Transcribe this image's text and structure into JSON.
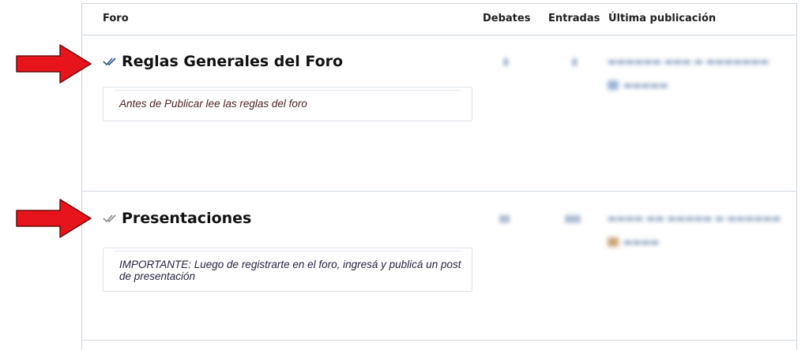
{
  "header": {
    "foro": "Foro",
    "debates": "Debates",
    "entradas": "Entradas",
    "ultima": "Última publicación"
  },
  "forums": [
    {
      "title": "Reglas Generales del Foro",
      "description": "Antes de Publicar lee las reglas del foro",
      "read_status": "read",
      "check_color": "#2c4f8f"
    },
    {
      "title": "Presentaciones",
      "description": "IMPORTANTE: Luego de registrarte en el foro, ingresá y publicá un post de presentación",
      "read_status": "read",
      "check_color": "#8a8a8a"
    }
  ],
  "colors": {
    "arrow": "#e8141c",
    "border": "#cfd6e0",
    "blurred_text": "#7f97b8"
  }
}
